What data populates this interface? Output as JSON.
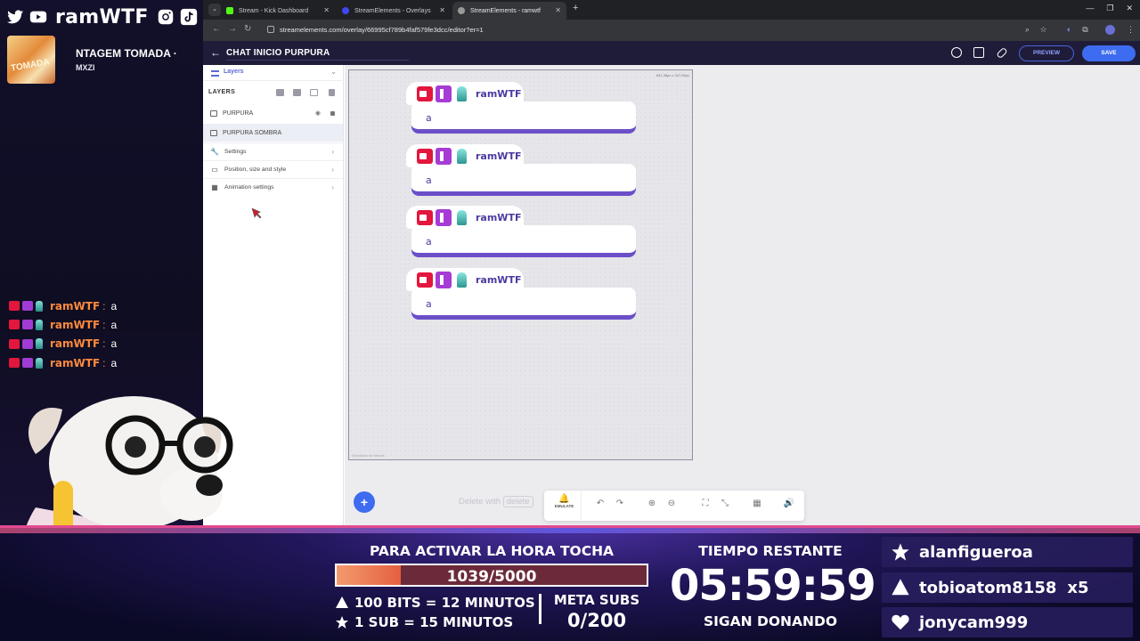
{
  "brand": {
    "name": "ramWTF",
    "icons": [
      "twitter-icon",
      "youtube-icon",
      "instagram-icon",
      "tiktok-icon"
    ]
  },
  "now_playing": {
    "title": "NTAGEM TOMADA ·",
    "artist": "MXZI",
    "art_text": "TOMADA"
  },
  "stream_chat": [
    {
      "name": "ramWTF",
      "sep": ":",
      "text": "a"
    },
    {
      "name": "ramWTF",
      "sep": ":",
      "text": "a"
    },
    {
      "name": "ramWTF",
      "sep": ":",
      "text": "a"
    },
    {
      "name": "ramWTF",
      "sep": ":",
      "text": "a"
    }
  ],
  "browser": {
    "tabs": [
      {
        "title": "Stream - Kick Dashboard",
        "active": false
      },
      {
        "title": "StreamElements - Overlays",
        "active": false
      },
      {
        "title": "StreamElements - ramwtf",
        "active": true
      }
    ],
    "new_tab": "+",
    "url": "streamelements.com/overlay/66995cf789b4faf579fe3dcc/editor?er=1"
  },
  "editor": {
    "overlay_title": "CHAT INICIO PURPURA",
    "preview_label": "PREVIEW",
    "save_label": "SAVE",
    "layers_tab": "Layers",
    "layers_section": "LAYERS",
    "layers": [
      {
        "name": "PURPURA",
        "selected": false
      },
      {
        "name": "PURPURA SOMBRA",
        "selected": true
      }
    ],
    "settings": [
      {
        "name": "Settings",
        "icon": "wrench-icon"
      },
      {
        "name": "Position, size and style",
        "icon": "position-icon"
      },
      {
        "name": "Animation settings",
        "icon": "clapper-icon"
      }
    ],
    "canvas_size": "631.38px x 347.65px",
    "canvas_footer": "Simulador de Alertas",
    "widget_messages": [
      {
        "name": "ramWTF",
        "text": "a"
      },
      {
        "name": "ramWTF",
        "text": "a"
      },
      {
        "name": "ramWTF",
        "text": "a"
      },
      {
        "name": "ramWTF",
        "text": "a"
      }
    ],
    "delete_hint": "Delete with",
    "delete_key": "delete",
    "emulate_label": "EMULATE"
  },
  "goal": {
    "title": "PARA ACTIVAR LA HORA TOCHA",
    "count": "1039/5000",
    "progress": 0.2078,
    "rules": [
      "100 BITS = 12 MINUTOS",
      "1 SUB = 15 MINUTOS"
    ],
    "meta_label": "META SUBS",
    "meta_value": "0/200"
  },
  "timer": {
    "label": "TIEMPO RESTANTE",
    "value": "05:59:59",
    "sub": "SIGAN DONANDO"
  },
  "donors": [
    {
      "name": "alanfigueroa",
      "icon": "star-icon",
      "extra": ""
    },
    {
      "name": "tobioatom8158",
      "icon": "triangle-icon",
      "extra": "x5"
    },
    {
      "name": "jonycam999",
      "icon": "heart-icon",
      "extra": ""
    }
  ],
  "colors": {
    "chat_name": "#ff8a3d",
    "accent_blue": "#3d6cf0",
    "widget_purple": "#6b4fc8",
    "bar_fill": "#e5603f"
  }
}
